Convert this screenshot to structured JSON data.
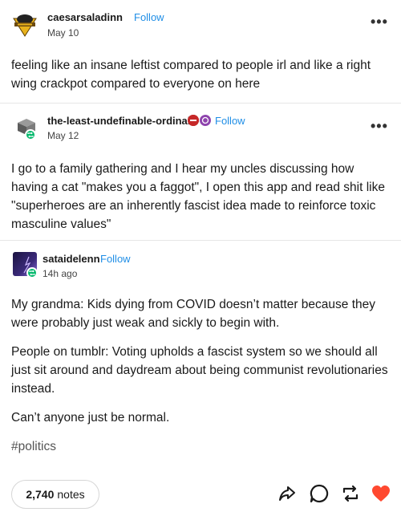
{
  "posts": [
    {
      "username": "caesarsaladinn",
      "follow_label": "Follow",
      "date": "May 10",
      "body": "feeling like an insane leftist compared to people irl and like a right wing crackpot compared to everyone on here"
    },
    {
      "username": "the-least-undefinable-ordinal",
      "follow_label": "Follow",
      "date": "May 12",
      "body": "I go to a family gathering and I hear my uncles discussing how having a cat \"makes you a faggot\", I open this app and read shit like \"superheroes are an inherently fascist idea made to reinforce toxic masculine values\""
    },
    {
      "username": "sataidelenn",
      "follow_label": "Follow",
      "date": "14h ago",
      "paragraphs": [
        "My grandma:  Kids dying from COVID doesn’t matter because they were probably just weak and sickly to begin with.",
        "People on tumblr:  Voting upholds a fascist system so we should all just sit around and daydream about being communist revolutionaries instead.",
        "Can’t anyone just be normal."
      ],
      "tag": "#politics"
    }
  ],
  "footer": {
    "notes_count": "2,740",
    "notes_label": "notes"
  },
  "colors": {
    "follow": "#1f8ee6",
    "badge": "#00b86b",
    "like": "#ff4930"
  },
  "icons": [
    "more-icon",
    "share-icon",
    "reply-icon",
    "reblog-icon",
    "like-icon"
  ]
}
